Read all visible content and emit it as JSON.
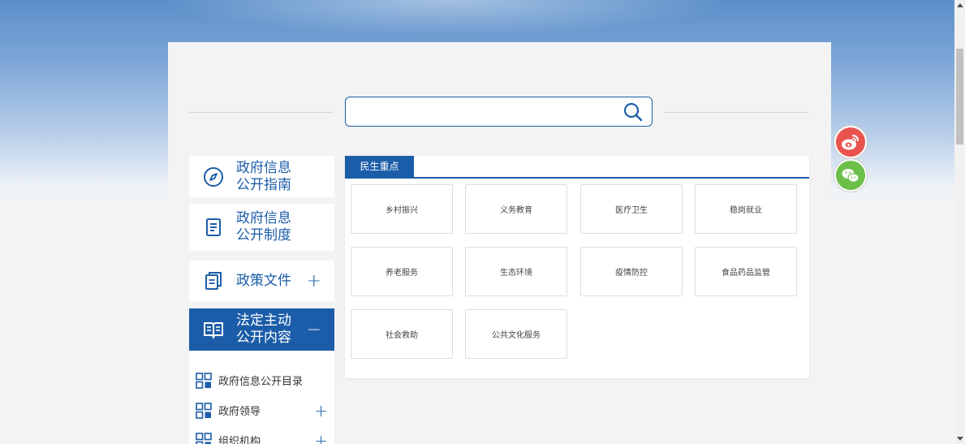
{
  "search": {
    "placeholder": ""
  },
  "sidebar": {
    "cards": [
      {
        "line1": "政府信息",
        "line2": "公开指南",
        "icon": "compass-icon"
      },
      {
        "line1": "政府信息",
        "line2": "公开制度",
        "icon": "document-list-icon"
      },
      {
        "line1": "政策文件",
        "toggle": "+",
        "icon": "documents-icon"
      },
      {
        "line1": "法定主动",
        "line2": "公开内容",
        "toggle": "−",
        "icon": "open-book-icon"
      }
    ],
    "subitems": [
      {
        "label": "政府信息公开目录"
      },
      {
        "label": "政府领导",
        "toggle": "+"
      },
      {
        "label": "组织机构",
        "toggle": "+"
      }
    ]
  },
  "panel": {
    "tab_label": "民生重点",
    "tiles": [
      "乡村振兴",
      "义务教育",
      "医疗卫生",
      "稳岗就业",
      "养老服务",
      "生态环境",
      "疫情防控",
      "食品药品监管",
      "社会救助",
      "公共文化服务"
    ]
  },
  "share": {
    "weibo_icon": "weibo-icon",
    "wechat_icon": "wechat-icon",
    "weibo_color": "#e9544f",
    "wechat_color": "#6cc04a"
  },
  "colors": {
    "brand": "#1c5da9"
  }
}
